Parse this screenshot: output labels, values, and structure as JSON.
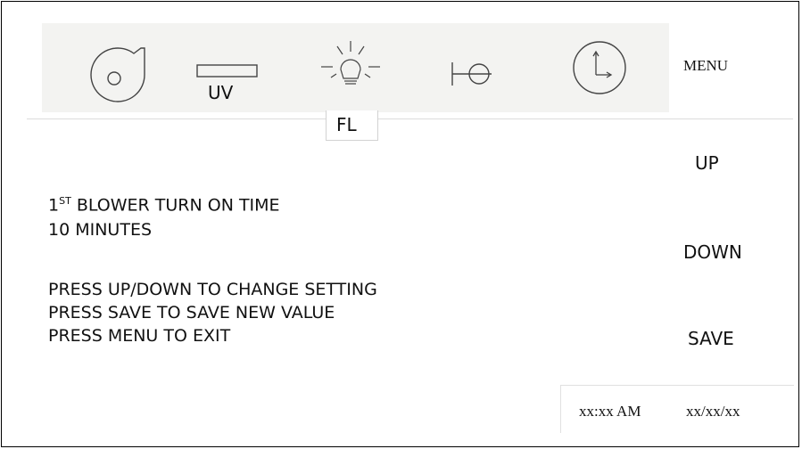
{
  "toolbar": {
    "icons": [
      "blower-icon",
      "uv-lamp-icon",
      "fl-light-icon",
      "sash-icon",
      "timer-icon"
    ],
    "uv_label": "UV",
    "fl_label": "FL",
    "menu_label": "MENU"
  },
  "message": {
    "setting_prefix": "1",
    "setting_sup": "ST",
    "setting_suffix": " BLOWER TURN ON TIME",
    "setting_value": "10 MINUTES",
    "instruction_1": "PRESS UP/DOWN TO CHANGE SETTING",
    "instruction_2": "PRESS SAVE TO SAVE NEW VALUE",
    "instruction_3": "PRESS MENU TO EXIT"
  },
  "side_buttons": {
    "up_label": "UP",
    "down_label": "DOWN",
    "save_label": "SAVE"
  },
  "status": {
    "time": "xx:xx",
    "ampm": "AM",
    "date": "xx/xx/xx"
  }
}
